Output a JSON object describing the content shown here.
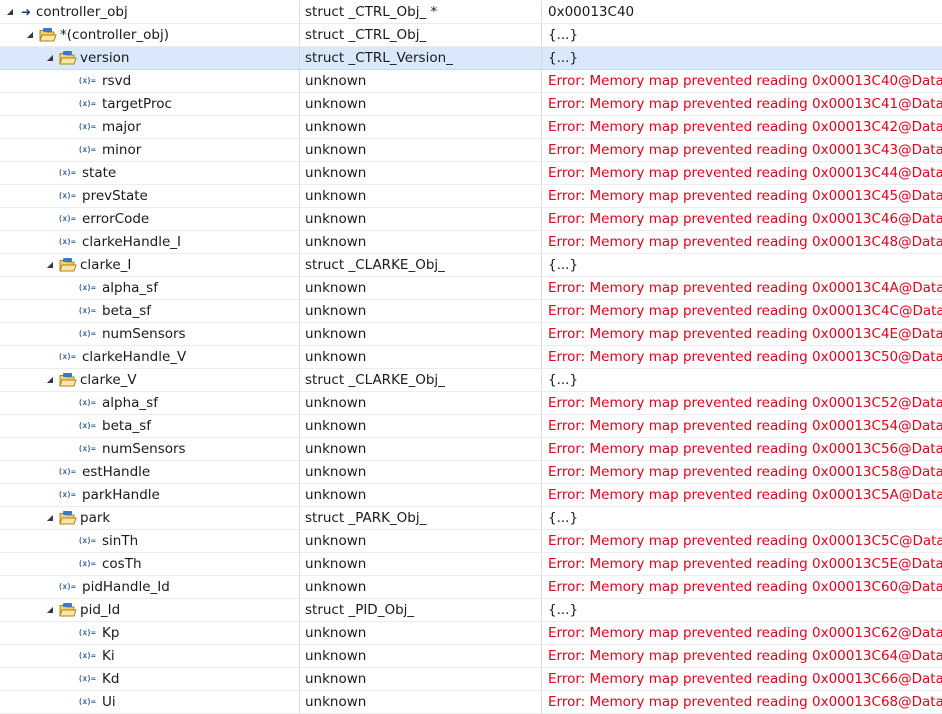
{
  "rows": [
    {
      "name": "controller_obj",
      "type": "struct _CTRL_Obj_ *",
      "value": "0x00013C40",
      "error": false,
      "icon": "pointer-arrow-icon",
      "depth": 0,
      "expandable": true
    },
    {
      "name": "*(controller_obj)",
      "type": "struct _CTRL_Obj_",
      "value": "{...}",
      "error": false,
      "icon": "struct-folder-icon",
      "depth": 1,
      "expandable": true
    },
    {
      "name": "version",
      "type": "struct _CTRL_Version_",
      "value": "{...}",
      "error": false,
      "icon": "struct-folder-icon",
      "depth": 2,
      "expandable": true,
      "selected": true
    },
    {
      "name": "rsvd",
      "type": "unknown",
      "value": "Error: Memory map prevented reading 0x00013C40@Data",
      "error": true,
      "icon": "variable-icon",
      "depth": 3,
      "expandable": false
    },
    {
      "name": "targetProc",
      "type": "unknown",
      "value": "Error: Memory map prevented reading 0x00013C41@Data",
      "error": true,
      "icon": "variable-icon",
      "depth": 3,
      "expandable": false
    },
    {
      "name": "major",
      "type": "unknown",
      "value": "Error: Memory map prevented reading 0x00013C42@Data",
      "error": true,
      "icon": "variable-icon",
      "depth": 3,
      "expandable": false
    },
    {
      "name": "minor",
      "type": "unknown",
      "value": "Error: Memory map prevented reading 0x00013C43@Data",
      "error": true,
      "icon": "variable-icon",
      "depth": 3,
      "expandable": false
    },
    {
      "name": "state",
      "type": "unknown",
      "value": "Error: Memory map prevented reading 0x00013C44@Data",
      "error": true,
      "icon": "variable-icon",
      "depth": 2,
      "expandable": false
    },
    {
      "name": "prevState",
      "type": "unknown",
      "value": "Error: Memory map prevented reading 0x00013C45@Data",
      "error": true,
      "icon": "variable-icon",
      "depth": 2,
      "expandable": false
    },
    {
      "name": "errorCode",
      "type": "unknown",
      "value": "Error: Memory map prevented reading 0x00013C46@Data",
      "error": true,
      "icon": "variable-icon",
      "depth": 2,
      "expandable": false
    },
    {
      "name": "clarkeHandle_I",
      "type": "unknown",
      "value": "Error: Memory map prevented reading 0x00013C48@Data",
      "error": true,
      "icon": "variable-icon",
      "depth": 2,
      "expandable": false
    },
    {
      "name": "clarke_I",
      "type": "struct _CLARKE_Obj_",
      "value": "{...}",
      "error": false,
      "icon": "struct-folder-icon",
      "depth": 2,
      "expandable": true
    },
    {
      "name": "alpha_sf",
      "type": "unknown",
      "value": "Error: Memory map prevented reading 0x00013C4A@Data",
      "error": true,
      "icon": "variable-icon",
      "depth": 3,
      "expandable": false
    },
    {
      "name": "beta_sf",
      "type": "unknown",
      "value": "Error: Memory map prevented reading 0x00013C4C@Data",
      "error": true,
      "icon": "variable-icon",
      "depth": 3,
      "expandable": false
    },
    {
      "name": "numSensors",
      "type": "unknown",
      "value": "Error: Memory map prevented reading 0x00013C4E@Data",
      "error": true,
      "icon": "variable-icon",
      "depth": 3,
      "expandable": false
    },
    {
      "name": "clarkeHandle_V",
      "type": "unknown",
      "value": "Error: Memory map prevented reading 0x00013C50@Data",
      "error": true,
      "icon": "variable-icon",
      "depth": 2,
      "expandable": false
    },
    {
      "name": "clarke_V",
      "type": "struct _CLARKE_Obj_",
      "value": "{...}",
      "error": false,
      "icon": "struct-folder-icon",
      "depth": 2,
      "expandable": true
    },
    {
      "name": "alpha_sf",
      "type": "unknown",
      "value": "Error: Memory map prevented reading 0x00013C52@Data",
      "error": true,
      "icon": "variable-icon",
      "depth": 3,
      "expandable": false
    },
    {
      "name": "beta_sf",
      "type": "unknown",
      "value": "Error: Memory map prevented reading 0x00013C54@Data",
      "error": true,
      "icon": "variable-icon",
      "depth": 3,
      "expandable": false
    },
    {
      "name": "numSensors",
      "type": "unknown",
      "value": "Error: Memory map prevented reading 0x00013C56@Data",
      "error": true,
      "icon": "variable-icon",
      "depth": 3,
      "expandable": false
    },
    {
      "name": "estHandle",
      "type": "unknown",
      "value": "Error: Memory map prevented reading 0x00013C58@Data",
      "error": true,
      "icon": "variable-icon",
      "depth": 2,
      "expandable": false
    },
    {
      "name": "parkHandle",
      "type": "unknown",
      "value": "Error: Memory map prevented reading 0x00013C5A@Data",
      "error": true,
      "icon": "variable-icon",
      "depth": 2,
      "expandable": false
    },
    {
      "name": "park",
      "type": "struct _PARK_Obj_",
      "value": "{...}",
      "error": false,
      "icon": "struct-folder-icon",
      "depth": 2,
      "expandable": true
    },
    {
      "name": "sinTh",
      "type": "unknown",
      "value": "Error: Memory map prevented reading 0x00013C5C@Data",
      "error": true,
      "icon": "variable-icon",
      "depth": 3,
      "expandable": false
    },
    {
      "name": "cosTh",
      "type": "unknown",
      "value": "Error: Memory map prevented reading 0x00013C5E@Data",
      "error": true,
      "icon": "variable-icon",
      "depth": 3,
      "expandable": false
    },
    {
      "name": "pidHandle_Id",
      "type": "unknown",
      "value": "Error: Memory map prevented reading 0x00013C60@Data",
      "error": true,
      "icon": "variable-icon",
      "depth": 2,
      "expandable": false
    },
    {
      "name": "pid_Id",
      "type": "struct _PID_Obj_",
      "value": "{...}",
      "error": false,
      "icon": "struct-folder-icon",
      "depth": 2,
      "expandable": true
    },
    {
      "name": "Kp",
      "type": "unknown",
      "value": "Error: Memory map prevented reading 0x00013C62@Data",
      "error": true,
      "icon": "variable-icon",
      "depth": 3,
      "expandable": false
    },
    {
      "name": "Ki",
      "type": "unknown",
      "value": "Error: Memory map prevented reading 0x00013C64@Data",
      "error": true,
      "icon": "variable-icon",
      "depth": 3,
      "expandable": false
    },
    {
      "name": "Kd",
      "type": "unknown",
      "value": "Error: Memory map prevented reading 0x00013C66@Data",
      "error": true,
      "icon": "variable-icon",
      "depth": 3,
      "expandable": false
    },
    {
      "name": "Ui",
      "type": "unknown",
      "value": "Error: Memory map prevented reading 0x00013C68@Data",
      "error": true,
      "icon": "variable-icon",
      "depth": 3,
      "expandable": false
    }
  ],
  "glyphs": {
    "expanded": "◢",
    "variable": "(x)="
  },
  "colors": {
    "error_text": "#e3001b",
    "selection_background": "#d9e9fb",
    "folder_fill": "#f3d26a",
    "folder_accent": "#3a78c8"
  }
}
